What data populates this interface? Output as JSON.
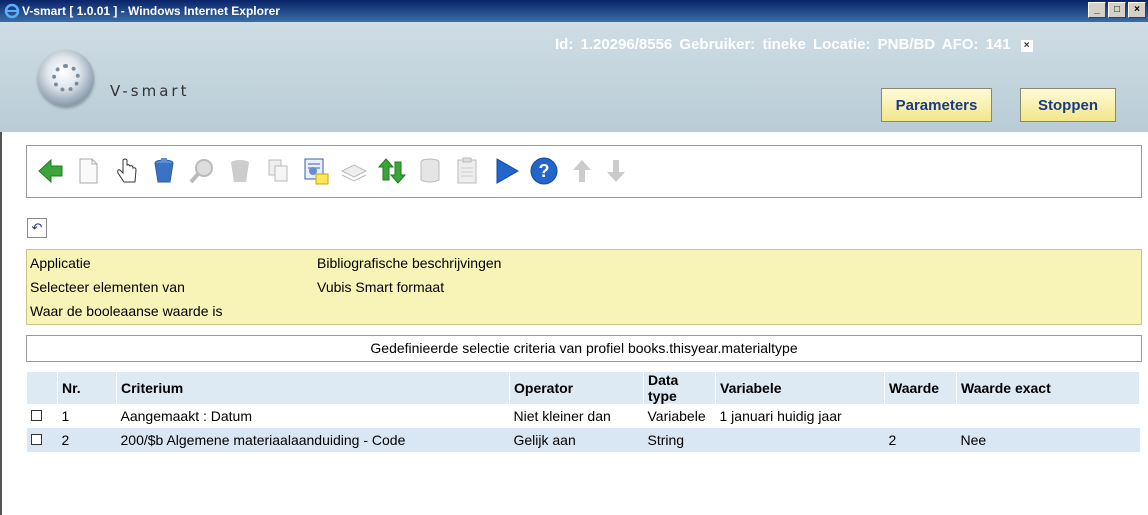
{
  "window": {
    "title": "V-smart [ 1.0.01 ] - Windows Internet Explorer",
    "min": "_",
    "max": "□",
    "close": "×"
  },
  "header": {
    "brand": "V-smart",
    "info": "Id: 1.20296/8556   Gebruiker: tineke   Locatie: PNB/BD   AFO: 141",
    "close": "×",
    "parameters_label": "Parameters",
    "stoppen_label": "Stoppen"
  },
  "toolbar": {
    "icons": [
      "back-arrow-icon",
      "new-document-icon",
      "hand-pointer-icon",
      "delete-bin-icon",
      "search-magnifier-icon",
      "bin-disabled-icon",
      "copy-icon",
      "settings-document-icon",
      "book-disabled-icon",
      "sort-arrows-icon",
      "database-icon",
      "clipboard-icon",
      "play-icon",
      "help-icon",
      "arrow-up-icon",
      "arrow-down-icon"
    ],
    "colors": {
      "green": "#3aa53a",
      "blue": "#2266cc",
      "grey": "#bbbbbb"
    }
  },
  "undo_icon": "↶",
  "info": {
    "rows": [
      {
        "label": "Applicatie",
        "value": "Bibliografische beschrijvingen"
      },
      {
        "label": "Selecteer elementen van",
        "value": "Vubis Smart formaat"
      },
      {
        "label": "Waar de booleaanse waarde is",
        "value": ""
      }
    ]
  },
  "subtitle": "Gedefinieerde selectie criteria van profiel books.thisyear.materialtype",
  "table": {
    "headers": [
      "",
      "Nr.",
      "Criterium",
      "Operator",
      "Data type",
      "Variabele",
      "Waarde",
      "Waarde exact"
    ],
    "rows": [
      {
        "nr": "1",
        "criterium": "Aangemaakt : Datum",
        "operator": "Niet kleiner dan",
        "datatype": "Variabele",
        "variabele": "1 januari huidig jaar",
        "waarde": "",
        "exact": ""
      },
      {
        "nr": "2",
        "criterium": "200/$b Algemene materiaalaanduiding - Code",
        "operator": "Gelijk aan",
        "datatype": "String",
        "variabele": "",
        "waarde": "2",
        "exact": "Nee"
      }
    ]
  }
}
